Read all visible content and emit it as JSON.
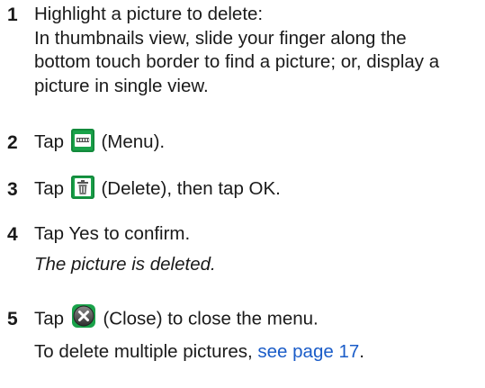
{
  "steps": [
    {
      "number": "1",
      "lines": [
        "Highlight a picture to delete:",
        "In thumbnails view, slide your finger along the",
        "bottom touch border to find a picture; or, display a",
        "picture in single view."
      ]
    },
    {
      "number": "2",
      "before": "Tap",
      "icon": "menu-icon",
      "after": "(Menu)."
    },
    {
      "number": "3",
      "before": "Tap",
      "icon": "trash-icon",
      "after": "(Delete), then tap OK."
    },
    {
      "number": "4",
      "text": "Tap Yes to confirm.",
      "result": "The picture is deleted."
    },
    {
      "number": "5",
      "before": "Tap",
      "icon": "close-icon",
      "after": "(Close) to close the menu.",
      "note_prefix": "To delete multiple pictures, ",
      "note_link": "see page 17",
      "note_suffix": "."
    }
  ],
  "colors": {
    "link": "#1a5cc8",
    "icon_green": "#1aa24a",
    "text": "#1a1a1a"
  }
}
